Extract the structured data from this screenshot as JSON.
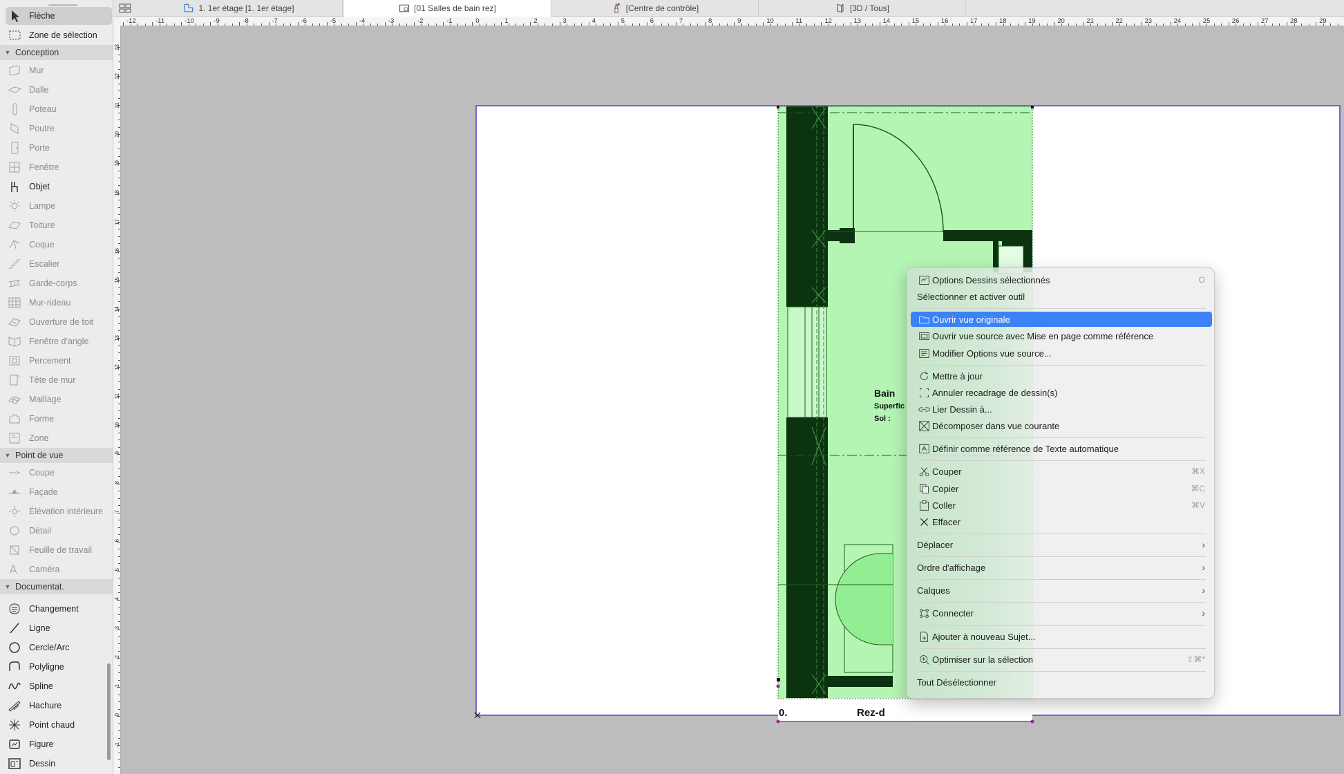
{
  "sidebar": {
    "tools_top": [
      {
        "label": "Flèche",
        "icon": "arrow-pointer-icon",
        "active": true
      },
      {
        "label": "Zone de sélection",
        "icon": "marquee-icon"
      }
    ],
    "sections": {
      "conception": "Conception",
      "point_de_vue": "Point de vue",
      "documentation": "Documentat."
    },
    "conception_tools": [
      {
        "label": "Mur",
        "icon": "wall-icon"
      },
      {
        "label": "Dalle",
        "icon": "slab-icon"
      },
      {
        "label": "Poteau",
        "icon": "column-icon"
      },
      {
        "label": "Poutre",
        "icon": "beam-icon"
      },
      {
        "label": "Porte",
        "icon": "door-icon"
      },
      {
        "label": "Fenêtre",
        "icon": "window-icon"
      },
      {
        "label": "Objet",
        "icon": "object-icon"
      },
      {
        "label": "Lampe",
        "icon": "lamp-icon"
      },
      {
        "label": "Toiture",
        "icon": "roof-icon"
      },
      {
        "label": "Coque",
        "icon": "shell-icon"
      },
      {
        "label": "Escalier",
        "icon": "stair-icon"
      },
      {
        "label": "Garde-corps",
        "icon": "railing-icon"
      },
      {
        "label": "Mur-rideau",
        "icon": "curtain-wall-icon"
      },
      {
        "label": "Ouverture de toit",
        "icon": "skylight-icon"
      },
      {
        "label": "Fenêtre d'angle",
        "icon": "corner-window-icon"
      },
      {
        "label": "Percement",
        "icon": "opening-icon"
      },
      {
        "label": "Tête de mur",
        "icon": "wall-end-icon"
      },
      {
        "label": "Maillage",
        "icon": "mesh-icon"
      },
      {
        "label": "Forme",
        "icon": "morph-icon"
      },
      {
        "label": "Zone",
        "icon": "zone-icon"
      }
    ],
    "view_tools": [
      {
        "label": "Coupe",
        "icon": "section-icon"
      },
      {
        "label": "Façade",
        "icon": "elevation-icon"
      },
      {
        "label": "Élévation intérieure",
        "icon": "interior-elevation-icon"
      },
      {
        "label": "Détail",
        "icon": "detail-icon"
      },
      {
        "label": "Feuille de travail",
        "icon": "worksheet-icon"
      },
      {
        "label": "Caméra",
        "icon": "camera-icon"
      }
    ],
    "doc_tools": [
      {
        "label": "Changement",
        "icon": "change-icon"
      },
      {
        "label": "Ligne",
        "icon": "line-icon"
      },
      {
        "label": "Cercle/Arc",
        "icon": "circle-icon"
      },
      {
        "label": "Polyligne",
        "icon": "polyline-icon"
      },
      {
        "label": "Spline",
        "icon": "spline-icon"
      },
      {
        "label": "Hachure",
        "icon": "hatch-icon"
      },
      {
        "label": "Point chaud",
        "icon": "hotspot-icon"
      },
      {
        "label": "Figure",
        "icon": "figure-icon"
      },
      {
        "label": "Dessin",
        "icon": "drawing-icon"
      }
    ]
  },
  "tabs": [
    {
      "label": "1. 1er étage [1. 1er étage]",
      "icon": "floor-plan-icon"
    },
    {
      "label": "[01 Salles de bain rez]",
      "icon": "layout-icon",
      "active": true
    },
    {
      "label": "[Centre de contrôle]",
      "icon": "lighthouse-icon"
    },
    {
      "label": "[3D / Tous]",
      "icon": "3d-icon"
    }
  ],
  "ruler_top": [
    "-12",
    "-11",
    "-10",
    "-9",
    "-8",
    "-7",
    "-6",
    "-5",
    "-4",
    "-3",
    "-2",
    "-1",
    "0",
    "1",
    "2",
    "3",
    "4",
    "5",
    "6",
    "7",
    "8",
    "9",
    "10",
    "11",
    "12",
    "13",
    "14",
    "15",
    "16",
    "17",
    "18",
    "19",
    "20",
    "21",
    "22",
    "23",
    "24",
    "25",
    "26",
    "27",
    "28",
    "29"
  ],
  "ruler_left": [
    "23",
    "22",
    "21",
    "20",
    "19",
    "18",
    "17",
    "16",
    "15",
    "14",
    "13",
    "12",
    "11",
    "10",
    "9",
    "8",
    "7",
    "6",
    "5",
    "4",
    "3",
    "2",
    "1",
    "0",
    "-1"
  ],
  "plan": {
    "room_name": "Bain",
    "room_area_label": "Superfic",
    "room_floor_label": "Sol :",
    "story_number": "0.",
    "story_title": "Rez-d"
  },
  "context_menu": {
    "items": [
      {
        "label": "Options Dessins sélectionnés",
        "icon": "drawing-options-icon",
        "shortcut": "O"
      },
      {
        "label": "Sélectionner et activer outil"
      },
      {
        "sep": true
      },
      {
        "label": "Ouvrir vue originale",
        "icon": "open-view-icon",
        "highlighted": true
      },
      {
        "label": "Ouvrir vue source avec Mise en page comme référence",
        "icon": "open-source-icon"
      },
      {
        "label": "Modifier Options vue source...",
        "icon": "view-options-icon"
      },
      {
        "sep": true
      },
      {
        "label": "Mettre à jour",
        "icon": "refresh-icon"
      },
      {
        "label": "Annuler recadrage de dessin(s)",
        "icon": "crop-icon"
      },
      {
        "label": "Lier Dessin à...",
        "icon": "link-icon"
      },
      {
        "label": "Décomposer dans vue courante",
        "icon": "explode-icon"
      },
      {
        "sep": true
      },
      {
        "label": "Définir comme référence de Texte automatique",
        "icon": "autotext-icon"
      },
      {
        "sep": true
      },
      {
        "label": "Couper",
        "icon": "scissors-icon",
        "shortcut": "⌘X"
      },
      {
        "label": "Copier",
        "icon": "copy-icon",
        "shortcut": "⌘C"
      },
      {
        "label": "Coller",
        "icon": "paste-icon",
        "shortcut": "⌘V"
      },
      {
        "label": "Effacer",
        "icon": "delete-x-icon"
      },
      {
        "sep": true
      },
      {
        "label": "Déplacer",
        "submenu": true
      },
      {
        "sep": true
      },
      {
        "label": "Ordre d'affichage",
        "submenu": true
      },
      {
        "sep": true
      },
      {
        "label": "Calques",
        "submenu": true
      },
      {
        "sep": true
      },
      {
        "label": "Connecter",
        "icon": "connect-icon",
        "submenu": true
      },
      {
        "sep": true
      },
      {
        "label": "Ajouter à nouveau Sujet...",
        "icon": "add-issue-icon"
      },
      {
        "sep": true
      },
      {
        "label": "Optimiser sur la sélection",
        "icon": "zoom-selection-icon",
        "shortcut": "⇧⌘*"
      },
      {
        "sep": true
      },
      {
        "label": "Tout Désélectionner"
      }
    ]
  },
  "colors": {
    "accent": "#3b82f6",
    "sheet_border": "#6b67d6",
    "zone_fill": "#b4f5b4",
    "wall_dark": "#0c3310"
  }
}
